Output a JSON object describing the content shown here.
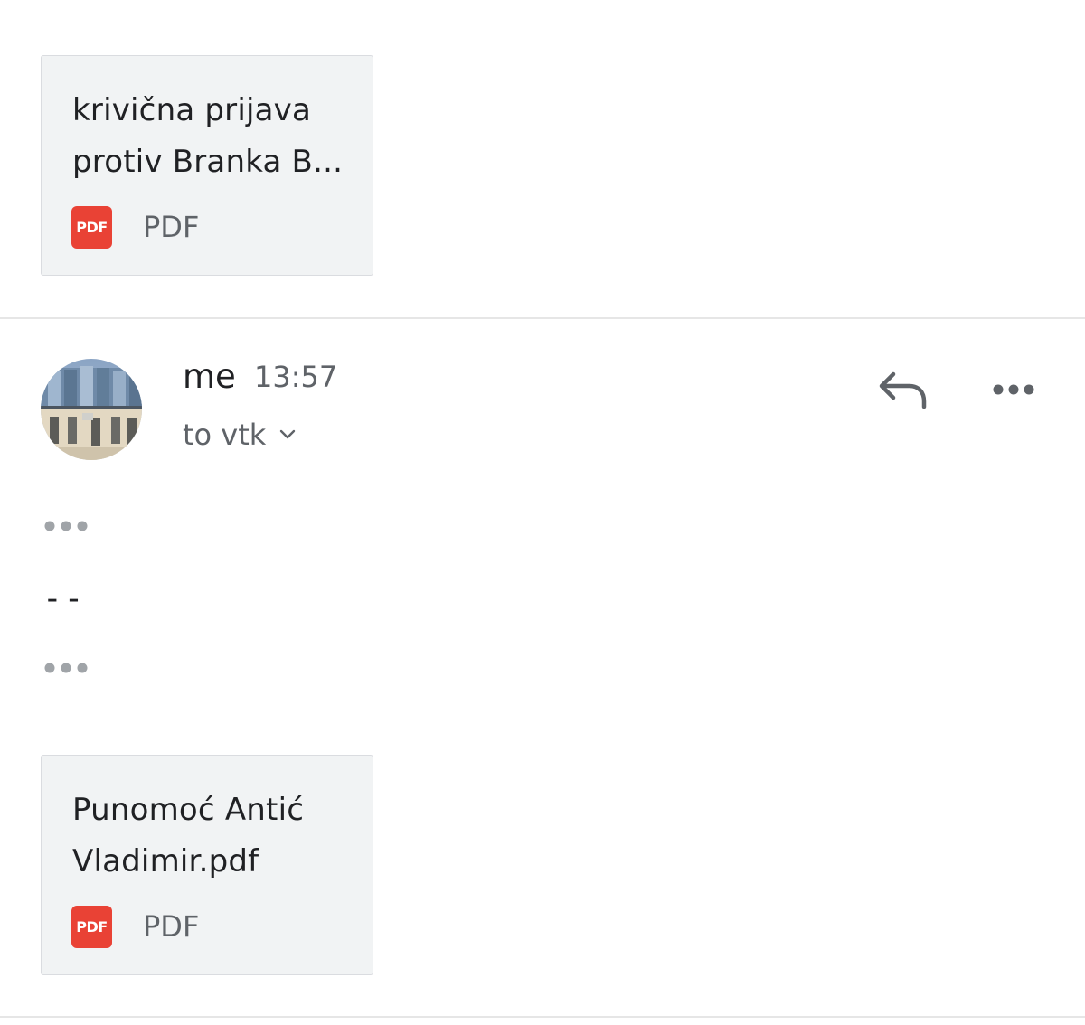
{
  "attachments": [
    {
      "name_lines": [
        "krivična prijava",
        "protiv Branka B..."
      ],
      "type_badge": "PDF",
      "type_label": "PDF"
    },
    {
      "name_lines": [
        "Punomoć Antić",
        "Vladimir.pdf"
      ],
      "type_badge": "PDF",
      "type_label": "PDF"
    }
  ],
  "message": {
    "sender": "me",
    "time": "13:57",
    "recipients": "to vtk",
    "signature": "--"
  },
  "icons": {
    "reply": "reply-icon",
    "more": "more-horizontal-icon",
    "expand_recipients": "chevron-down-icon",
    "trimmed_content": "ellipsis-icon",
    "file_type": "pdf-icon"
  },
  "colors": {
    "pdf_badge": "#e94235",
    "card_background": "#f1f3f4",
    "secondary_text": "#5f6368",
    "primary_text": "#202124"
  }
}
